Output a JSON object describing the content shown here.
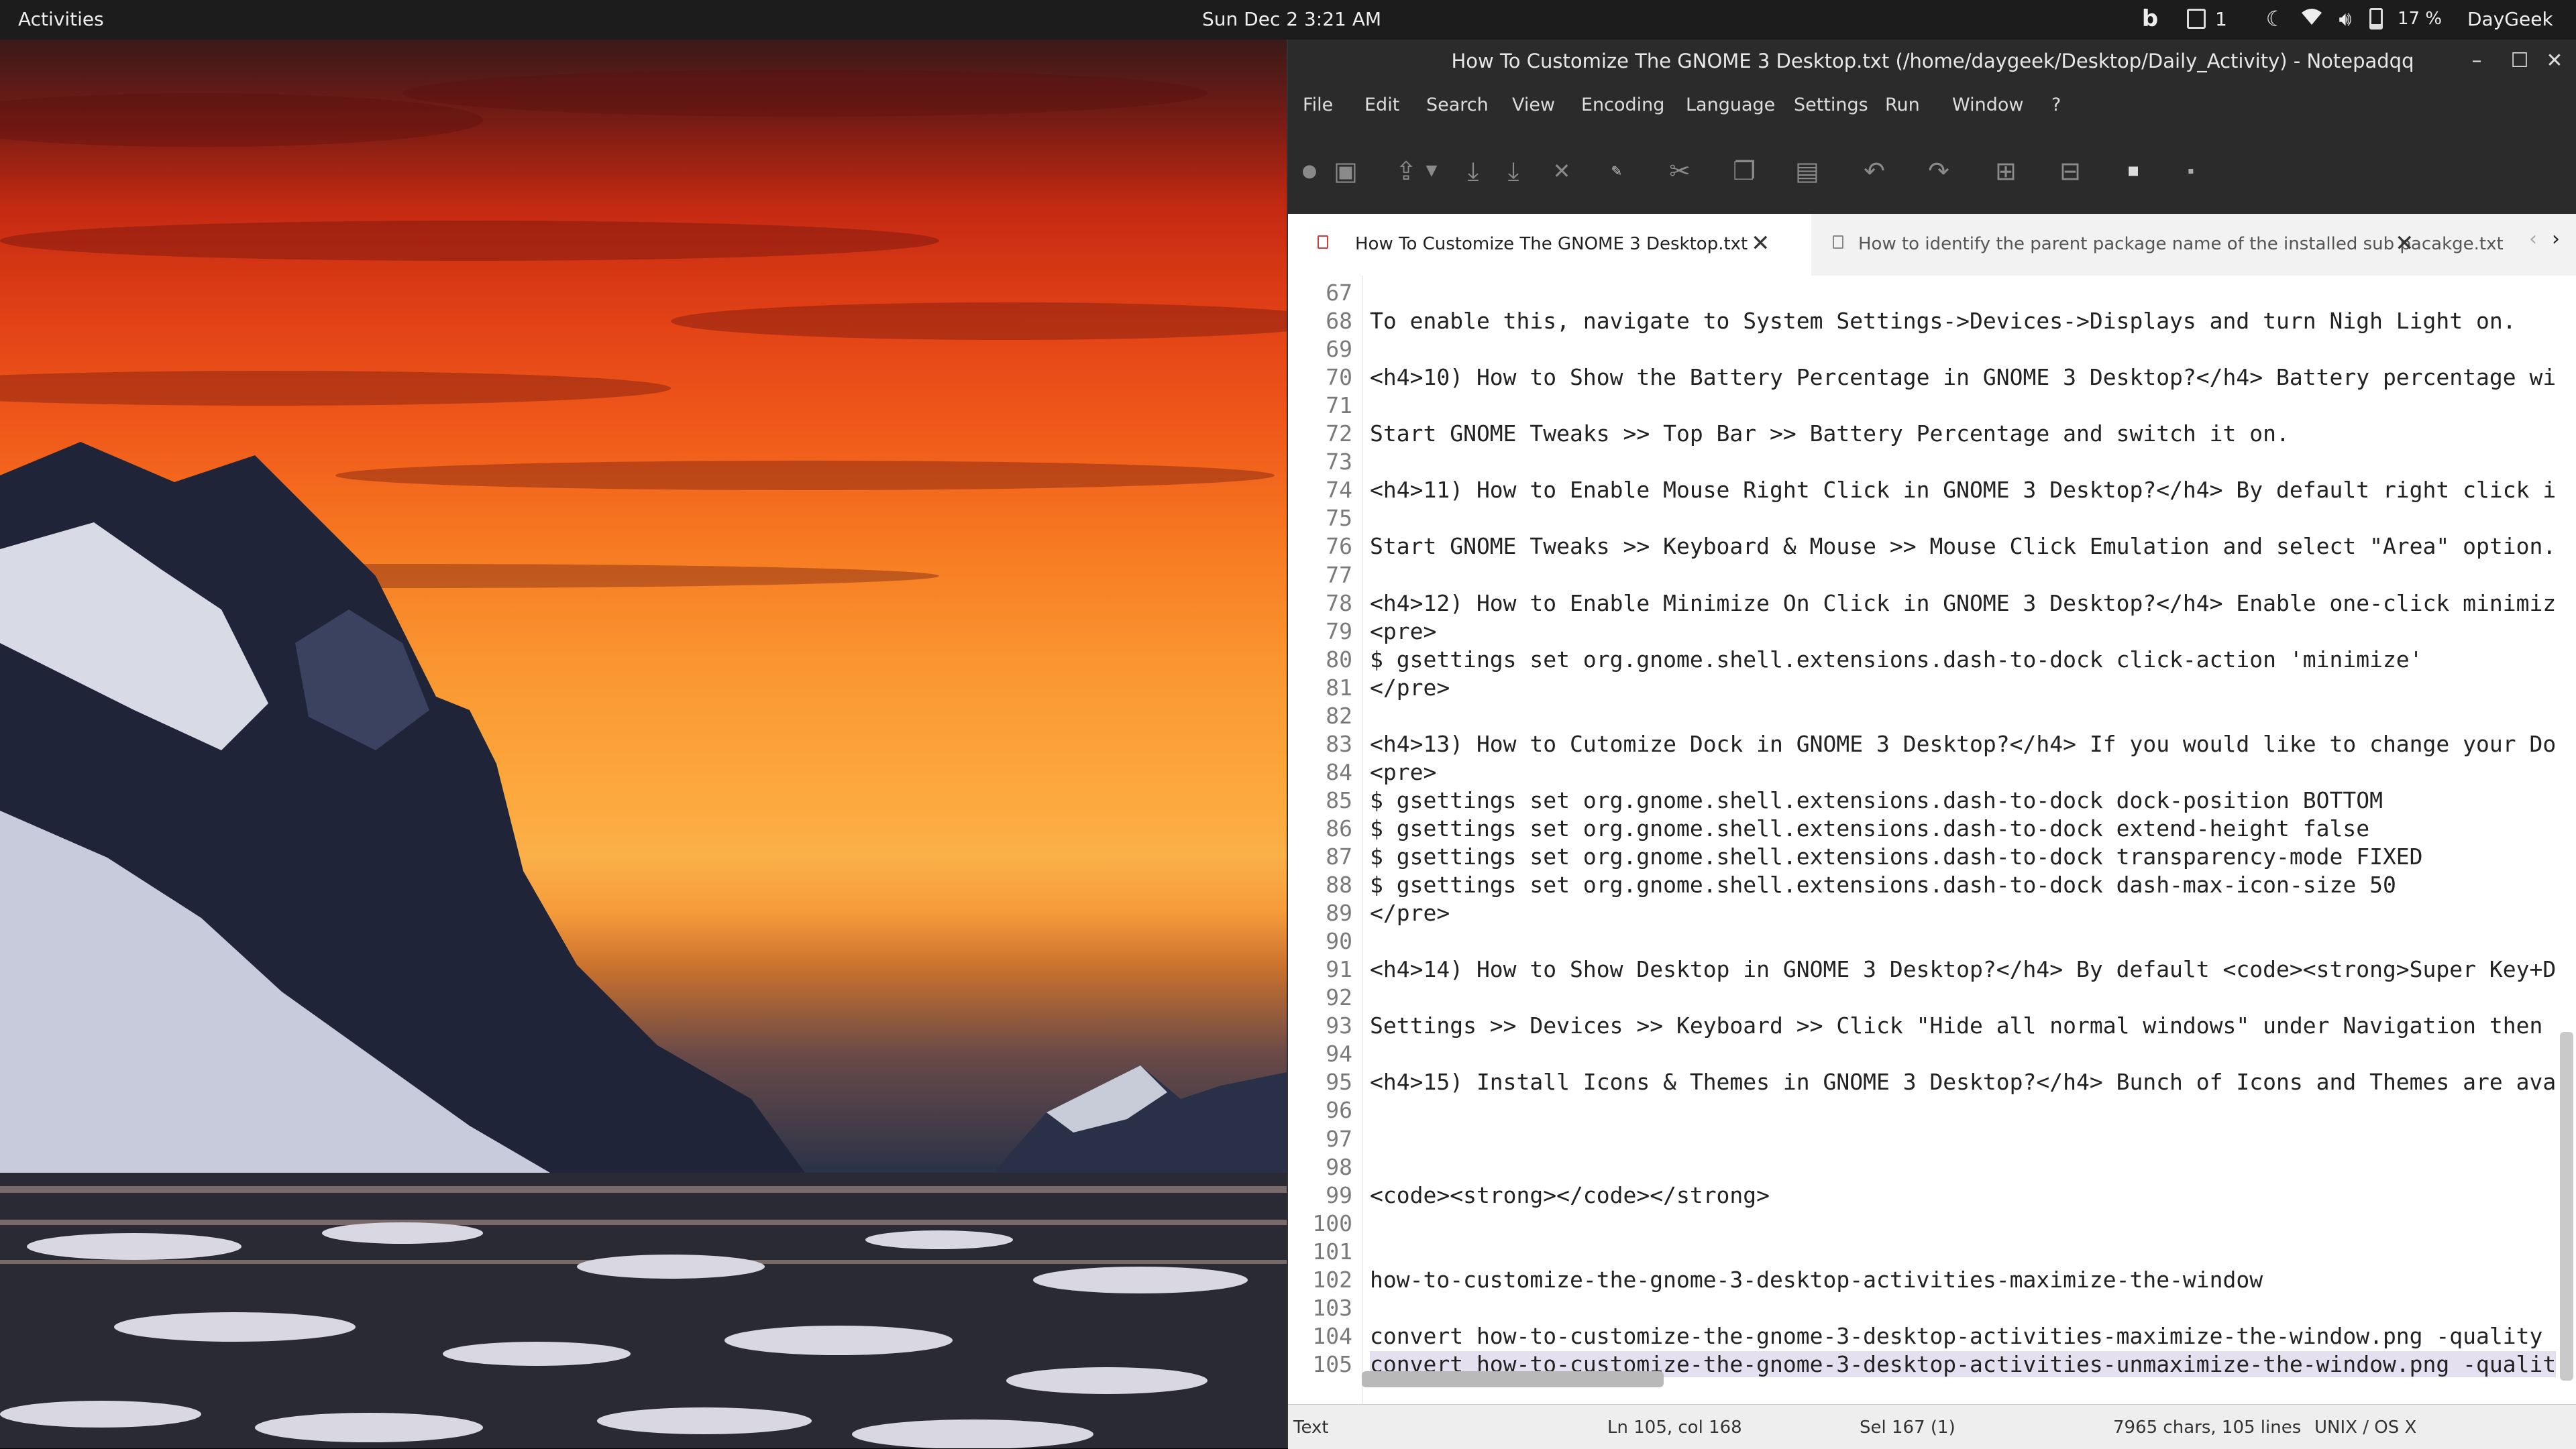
{
  "topbar": {
    "activities": "Activities",
    "clock": "Sun Dec 2  3:21 AM",
    "notif_count": "1",
    "battery": "17 %",
    "user": "DayGeek",
    "icons": [
      "bing-icon",
      "notification-icon",
      "night-light-icon",
      "wifi-icon",
      "volume-icon",
      "battery-icon"
    ]
  },
  "window": {
    "title": "How To Customize The GNOME 3 Desktop.txt (/home/daygeek/Desktop/Daily_Activity) - Notepadqq",
    "minimize": "–",
    "maximize": "☐",
    "close": "✕"
  },
  "menu": [
    "File",
    "Edit",
    "Search",
    "View",
    "Encoding",
    "Language",
    "Settings",
    "Run",
    "Window",
    "?"
  ],
  "toolbar": [
    "new-file-icon",
    "add-file-icon",
    "open-file-icon",
    "dropdown-icon",
    "save-icon",
    "save-all-icon",
    "close-file-icon",
    "pencil-icon",
    "cut-icon",
    "copy-icon",
    "paste-icon",
    "undo-icon",
    "redo-icon",
    "zoom-in-icon",
    "zoom-out-icon",
    "word-wrap-icon",
    "whitespace-icon"
  ],
  "tabs": [
    {
      "label": "How To Customize The GNOME 3 Desktop.txt",
      "close": "✕"
    },
    {
      "label": "How to identify the parent package name of the installed sub pacakge.txt",
      "close": "✕"
    }
  ],
  "lines": [
    {
      "n": "67",
      "t": ""
    },
    {
      "n": "68",
      "t": "To enable this, navigate to System Settings->Devices->Displays and turn Nigh Light on."
    },
    {
      "n": "69",
      "t": ""
    },
    {
      "n": "70",
      "t": "<h4>10) How to Show the Battery Percentage in GNOME 3 Desktop?</h4> Battery percentage wi"
    },
    {
      "n": "71",
      "t": ""
    },
    {
      "n": "72",
      "t": "Start GNOME Tweaks >> Top Bar >> Battery Percentage and switch it on."
    },
    {
      "n": "73",
      "t": ""
    },
    {
      "n": "74",
      "t": "<h4>11) How to Enable Mouse Right Click in GNOME 3 Desktop?</h4> By default right click i"
    },
    {
      "n": "75",
      "t": ""
    },
    {
      "n": "76",
      "t": "Start GNOME Tweaks >> Keyboard & Mouse >> Mouse Click Emulation and select \"Area\" option."
    },
    {
      "n": "77",
      "t": ""
    },
    {
      "n": "78",
      "t": "<h4>12) How to Enable Minimize On Click in GNOME 3 Desktop?</h4> Enable one-click minimiz"
    },
    {
      "n": "79",
      "t": "<pre>"
    },
    {
      "n": "80",
      "t": "$ gsettings set org.gnome.shell.extensions.dash-to-dock click-action 'minimize'"
    },
    {
      "n": "81",
      "t": "</pre>"
    },
    {
      "n": "82",
      "t": ""
    },
    {
      "n": "83",
      "t": "<h4>13) How to Cutomize Dock in GNOME 3 Desktop?</h4> If you would like to change your Do"
    },
    {
      "n": "84",
      "t": "<pre>"
    },
    {
      "n": "85",
      "t": "$ gsettings set org.gnome.shell.extensions.dash-to-dock dock-position BOTTOM"
    },
    {
      "n": "86",
      "t": "$ gsettings set org.gnome.shell.extensions.dash-to-dock extend-height false"
    },
    {
      "n": "87",
      "t": "$ gsettings set org.gnome.shell.extensions.dash-to-dock transparency-mode FIXED"
    },
    {
      "n": "88",
      "t": "$ gsettings set org.gnome.shell.extensions.dash-to-dock dash-max-icon-size 50"
    },
    {
      "n": "89",
      "t": "</pre>"
    },
    {
      "n": "90",
      "t": ""
    },
    {
      "n": "91",
      "t": "<h4>14) How to Show Desktop in GNOME 3 Desktop?</h4> By default <code><strong>Super Key+D"
    },
    {
      "n": "92",
      "t": ""
    },
    {
      "n": "93",
      "t": "Settings >> Devices >> Keyboard >> Click \"Hide all normal windows\" under Navigation then"
    },
    {
      "n": "94",
      "t": ""
    },
    {
      "n": "95",
      "t": "<h4>15) Install Icons & Themes in GNOME 3 Desktop?</h4> Bunch of Icons and Themes are ava"
    },
    {
      "n": "96",
      "t": ""
    },
    {
      "n": "97",
      "t": ""
    },
    {
      "n": "98",
      "t": ""
    },
    {
      "n": "99",
      "t": "<code><strong></code></strong>"
    },
    {
      "n": "100",
      "t": ""
    },
    {
      "n": "101",
      "t": ""
    },
    {
      "n": "102",
      "t": "how-to-customize-the-gnome-3-desktop-activities-maximize-the-window"
    },
    {
      "n": "103",
      "t": ""
    },
    {
      "n": "104",
      "t": "convert how-to-customize-the-gnome-3-desktop-activities-maximize-the-window.png -quality"
    },
    {
      "n": "105",
      "t": "convert how-to-customize-the-gnome-3-desktop-activities-unmaximize-the-window.png -qualit"
    }
  ],
  "status": {
    "language": "Text",
    "position": "Ln 105, col 168",
    "selection": "Sel 167 (1)",
    "counts": "7965 chars, 105 lines",
    "eol": "UNIX / OS X"
  },
  "colors": {
    "topbar": "#1c1c1c",
    "titlebar": "#2b2b2b",
    "selection": "#e4e0f0",
    "tab_icon": "#d23c3c"
  }
}
